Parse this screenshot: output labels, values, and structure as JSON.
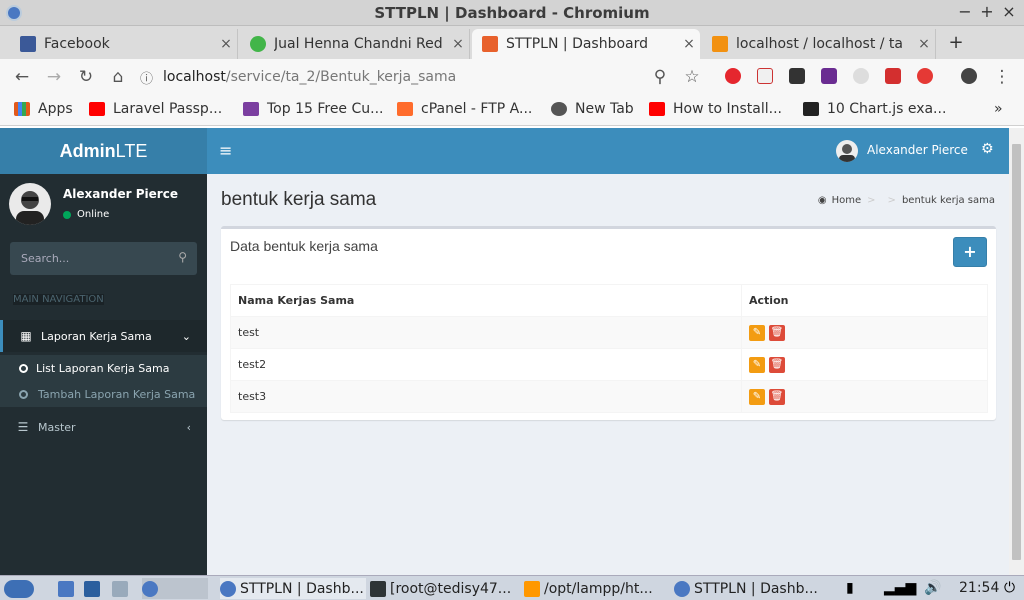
{
  "window": {
    "title": "STTPLN | Dashboard - Chromium",
    "controls": [
      "−",
      "+",
      "×"
    ]
  },
  "tabs": [
    {
      "label": "Facebook",
      "color": "#3b5998"
    },
    {
      "label": "Jual Henna Chandni Red",
      "color": "#42b549"
    },
    {
      "label": "STTPLN | Dashboard",
      "color": "#e8612c",
      "active": true
    },
    {
      "label": "localhost / localhost / ta",
      "color": "#f29111"
    }
  ],
  "toolbar": {
    "back": "←",
    "forward": "→",
    "reload": "↻",
    "home": "⌂",
    "url_host": "localhost",
    "url_path": "/service/ta_2/Bentuk_kerja_sama",
    "zoom_icon": "⚲",
    "star": "☆",
    "menu": "⋮"
  },
  "bookmarks": [
    {
      "label": "Apps",
      "color": "#e25a1c"
    },
    {
      "label": "Laravel Passp...",
      "color": "#ff0000"
    },
    {
      "label": "Top 15 Free Cu...",
      "color": "#7b3fa0"
    },
    {
      "label": "cPanel - FTP A...",
      "color": "#ff6c2c"
    },
    {
      "label": "New Tab",
      "color": "#555555"
    },
    {
      "label": "How to Install...",
      "color": "#ff0000"
    },
    {
      "label": "10 Chart.js exa...",
      "color": "#222222"
    }
  ],
  "bookmarks_more": "»",
  "app": {
    "logo_bold": "Admin",
    "logo_light": "LTE",
    "hamburger": "≡",
    "user_name": "Alexander Pierce",
    "gear": "⚙"
  },
  "sidebar": {
    "user_name": "Alexander Pierce",
    "status": "Online",
    "search_placeholder": "Search...",
    "search_icon": "⚲",
    "header": "MAIN NAVIGATION",
    "menu_laporan": "Laporan Kerja Sama",
    "menu_laporan_chevron": "⌄",
    "sub_list": "List Laporan Kerja Sama",
    "sub_tambah": "Tambah Laporan Kerja Sama",
    "menu_master": "Master",
    "menu_master_chevron": "‹"
  },
  "content": {
    "title": "bentuk kerja sama",
    "breadcrumb_home": "Home",
    "breadcrumb_current": "bentuk kerja sama",
    "box_title": "Data bentuk kerja sama",
    "add_label": "+",
    "columns": [
      "Nama Kerjas Sama",
      "Action"
    ],
    "rows": [
      {
        "name": "test"
      },
      {
        "name": "test2"
      },
      {
        "name": "test3"
      }
    ],
    "edit_glyph": "✎",
    "delete_glyph": "🗑"
  },
  "taskbar": {
    "items": [
      "STTPLN | Dashb...",
      "[root@tedisy47...",
      "/opt/lampp/ht...",
      "STTPLN | Dashb..."
    ],
    "clock": "21:54"
  }
}
